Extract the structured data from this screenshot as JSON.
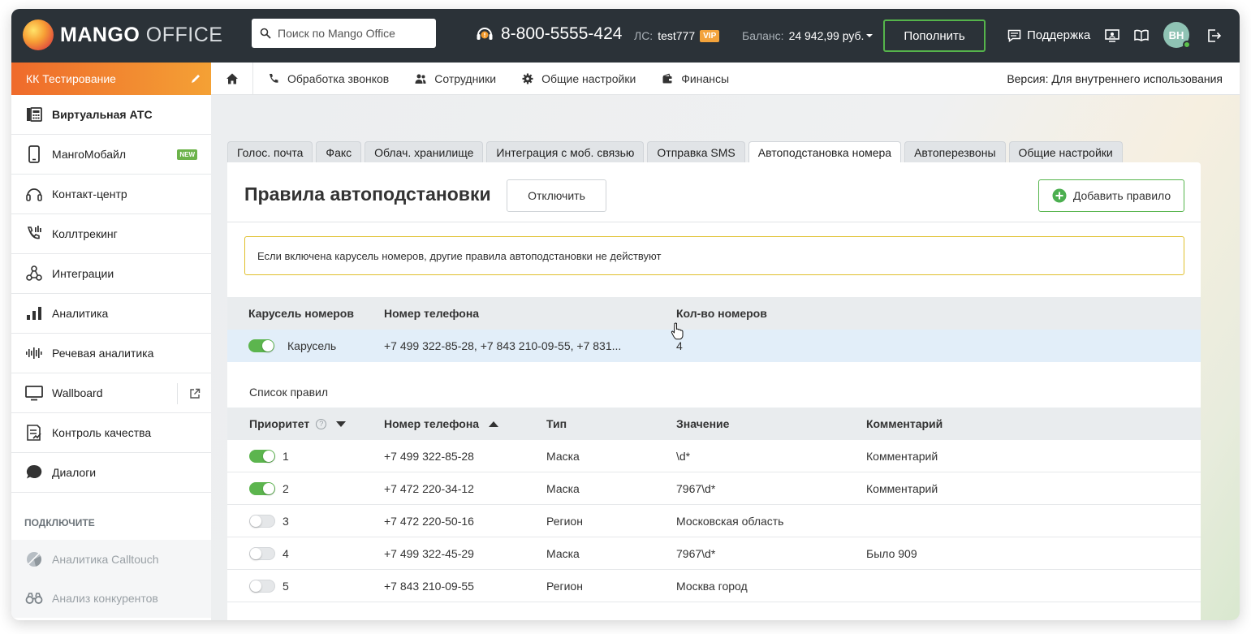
{
  "header": {
    "logo_main": "MANGO",
    "logo_sub": "OFFICE",
    "search_placeholder": "Поиск по Mango Office",
    "phone": "8-800-5555-424",
    "account_label": "ЛС:",
    "account_value": "test777",
    "vip_badge": "VIP",
    "balance_label": "Баланс:",
    "balance_value": "24 942,99 руб.",
    "topup_label": "Пополнить",
    "support_label": "Поддержка",
    "avatar_initials": "ВН",
    "icons": [
      "search-icon",
      "headset-icon",
      "chevron-down-icon",
      "chat-icon",
      "monitor-icon",
      "book-icon",
      "logout-icon"
    ]
  },
  "sidebar": {
    "project_name": "КК Тестирование",
    "items": [
      {
        "label": "Виртуальная АТС",
        "icon": "pbx-icon"
      },
      {
        "label": "МангоМобайл",
        "icon": "mobile-icon",
        "badge": "NEW"
      },
      {
        "label": "Контакт-центр",
        "icon": "headphones-icon"
      },
      {
        "label": "Коллтрекинг",
        "icon": "calltracking-icon"
      },
      {
        "label": "Интеграции",
        "icon": "integrations-icon"
      },
      {
        "label": "Аналитика",
        "icon": "bar-chart-icon"
      },
      {
        "label": "Речевая аналитика",
        "icon": "waveform-icon"
      },
      {
        "label": "Wallboard",
        "icon": "monitor-icon"
      },
      {
        "label": "Контроль качества",
        "icon": "checklist-icon"
      },
      {
        "label": "Диалоги",
        "icon": "dialog-icon"
      }
    ],
    "connect_heading": "ПОДКЛЮЧИТЕ",
    "connect_items": [
      {
        "label": "Аналитика Calltouch",
        "icon": "calltouch-icon"
      },
      {
        "label": "Анализ конкурентов",
        "icon": "binoculars-icon"
      }
    ]
  },
  "topnav": {
    "items": [
      {
        "label": "Обработка звонков",
        "icon": "phone-icon"
      },
      {
        "label": "Сотрудники",
        "icon": "users-icon"
      },
      {
        "label": "Общие настройки",
        "icon": "gear-icon"
      },
      {
        "label": "Финансы",
        "icon": "wallet-icon"
      }
    ],
    "version": "Версия: Для внутреннего использования"
  },
  "tabs": [
    "Голос. почта",
    "Факс",
    "Облач. хранилище",
    "Интеграция с моб. связью",
    "Отправка SMS",
    "Автоподстановка номера",
    "Автоперезвоны",
    "Общие настройки"
  ],
  "active_tab": "Автоподстановка номера",
  "panel": {
    "title": "Правила автоподстановки",
    "disable_button": "Отключить",
    "add_button": "Добавить правило",
    "notice": "Если включена карусель номеров, другие правила автоподстановки не действуют"
  },
  "carousel_table": {
    "headers": [
      "Карусель номеров",
      "Номер телефона",
      "Кол-во номеров"
    ],
    "row": {
      "enabled": true,
      "name": "Карусель",
      "phones": "+7 499 322-85-28, +7 843 210-09-55, +7 831...",
      "count": "4"
    }
  },
  "rules": {
    "section_title": "Список правил",
    "headers": [
      "Приоритет",
      "Номер телефона",
      "Тип",
      "Значение",
      "Комментарий"
    ],
    "help_glyph": "?",
    "rows": [
      {
        "enabled": true,
        "priority": "1",
        "phone": "+7 499 322-85-28",
        "type": "Маска",
        "value": "\\d*",
        "comment": "Комментарий"
      },
      {
        "enabled": true,
        "priority": "2",
        "phone": "+7 472 220-34-12",
        "type": "Маска",
        "value": "7967\\d*",
        "comment": "Комментарий"
      },
      {
        "enabled": false,
        "priority": "3",
        "phone": "+7 472 220-50-16",
        "type": "Регион",
        "value": "Московская область",
        "comment": ""
      },
      {
        "enabled": false,
        "priority": "4",
        "phone": "+7 499 322-45-29",
        "type": "Маска",
        "value": "7967\\d*",
        "comment": "Было 909"
      },
      {
        "enabled": false,
        "priority": "5",
        "phone": "+7 843 210-09-55",
        "type": "Регион",
        "value": "Москва город",
        "comment": ""
      }
    ]
  },
  "colors": {
    "header_bg": "#2b3238",
    "accent_green": "#5cb54e",
    "project_gradient_start": "#ef6a2b",
    "project_gradient_end": "#f4a135",
    "notice_border": "#e0c02c",
    "highlight_row": "#e2eef9"
  }
}
